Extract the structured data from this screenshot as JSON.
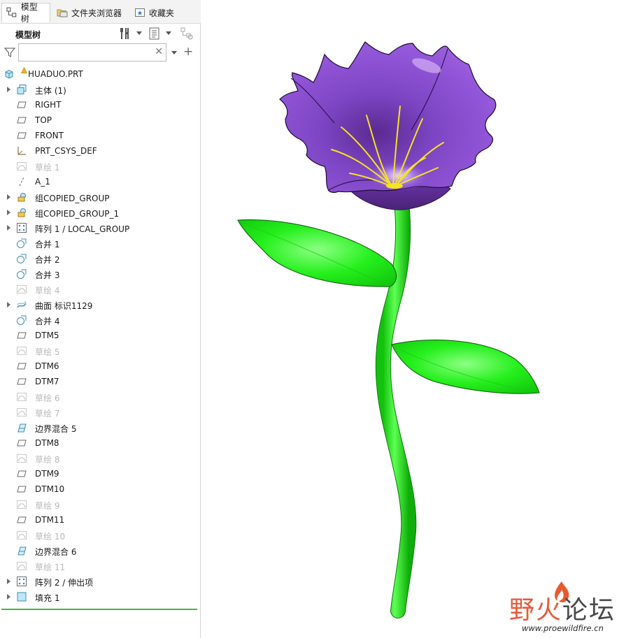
{
  "tabs": [
    {
      "label": "模型树",
      "icon": "model-tree-icon",
      "active": true
    },
    {
      "label": "文件夹浏览器",
      "icon": "folder-browser-icon",
      "active": false
    },
    {
      "label": "收藏夹",
      "icon": "favorites-icon",
      "active": false
    }
  ],
  "tree_header": {
    "title": "模型树"
  },
  "search": {
    "value": "",
    "placeholder": ""
  },
  "tree": [
    {
      "label": "HUADUO.PRT",
      "icon": "part-icon",
      "expandable": false,
      "dim": false,
      "root": true,
      "warning": true
    },
    {
      "label": "主体 (1)",
      "icon": "body-icon",
      "expandable": true,
      "dim": false
    },
    {
      "label": "RIGHT",
      "icon": "datum-plane-icon",
      "expandable": false,
      "dim": false
    },
    {
      "label": "TOP",
      "icon": "datum-plane-icon",
      "expandable": false,
      "dim": false
    },
    {
      "label": "FRONT",
      "icon": "datum-plane-icon",
      "expandable": false,
      "dim": false
    },
    {
      "label": "PRT_CSYS_DEF",
      "icon": "coordinate-system-icon",
      "expandable": false,
      "dim": false
    },
    {
      "label": "草绘 1",
      "icon": "sketch-icon",
      "expandable": false,
      "dim": true
    },
    {
      "label": "A_1",
      "icon": "datum-axis-icon",
      "expandable": false,
      "dim": false
    },
    {
      "label": "组COPIED_GROUP",
      "icon": "group-icon",
      "expandable": true,
      "dim": false
    },
    {
      "label": "组COPIED_GROUP_1",
      "icon": "group-icon",
      "expandable": true,
      "dim": false
    },
    {
      "label": "阵列 1 / LOCAL_GROUP",
      "icon": "pattern-icon",
      "expandable": true,
      "dim": false
    },
    {
      "label": "合并 1",
      "icon": "merge-icon",
      "expandable": false,
      "dim": false
    },
    {
      "label": "合并 2",
      "icon": "merge-icon",
      "expandable": false,
      "dim": false
    },
    {
      "label": "合并 3",
      "icon": "merge-icon",
      "expandable": false,
      "dim": false
    },
    {
      "label": "草绘 4",
      "icon": "sketch-icon",
      "expandable": false,
      "dim": true
    },
    {
      "label": "曲面 标识1129",
      "icon": "surface-icon",
      "expandable": true,
      "dim": false
    },
    {
      "label": "合并 4",
      "icon": "merge-icon",
      "expandable": false,
      "dim": false
    },
    {
      "label": "DTM5",
      "icon": "datum-plane-icon",
      "expandable": false,
      "dim": false
    },
    {
      "label": "草绘 5",
      "icon": "sketch-icon",
      "expandable": false,
      "dim": true
    },
    {
      "label": "DTM6",
      "icon": "datum-plane-icon",
      "expandable": false,
      "dim": false
    },
    {
      "label": "DTM7",
      "icon": "datum-plane-icon",
      "expandable": false,
      "dim": false
    },
    {
      "label": "草绘 6",
      "icon": "sketch-icon",
      "expandable": false,
      "dim": true
    },
    {
      "label": "草绘 7",
      "icon": "sketch-icon",
      "expandable": false,
      "dim": true
    },
    {
      "label": "边界混合 5",
      "icon": "boundary-blend-icon",
      "expandable": false,
      "dim": false
    },
    {
      "label": "DTM8",
      "icon": "datum-plane-icon",
      "expandable": false,
      "dim": false
    },
    {
      "label": "草绘 8",
      "icon": "sketch-icon",
      "expandable": false,
      "dim": true
    },
    {
      "label": "DTM9",
      "icon": "datum-plane-icon",
      "expandable": false,
      "dim": false
    },
    {
      "label": "DTM10",
      "icon": "datum-plane-icon",
      "expandable": false,
      "dim": false
    },
    {
      "label": "草绘 9",
      "icon": "sketch-icon",
      "expandable": false,
      "dim": true
    },
    {
      "label": "DTM11",
      "icon": "datum-plane-icon",
      "expandable": false,
      "dim": false
    },
    {
      "label": "草绘 10",
      "icon": "sketch-icon",
      "expandable": false,
      "dim": true
    },
    {
      "label": "边界混合 6",
      "icon": "boundary-blend-icon",
      "expandable": false,
      "dim": false
    },
    {
      "label": "草绘 11",
      "icon": "sketch-icon",
      "expandable": false,
      "dim": true
    },
    {
      "label": "阵列 2 / 伸出项",
      "icon": "pattern-icon",
      "expandable": true,
      "dim": false
    },
    {
      "label": "填充 1",
      "icon": "fill-icon",
      "expandable": true,
      "dim": false
    }
  ],
  "watermark": {
    "title_part1": "野火",
    "title_part2": "论坛",
    "url": "www.proewildfire.cn"
  },
  "colors": {
    "petal": "#8a4fd0",
    "petal_dark": "#5a2c8c",
    "stamen": "#f3e21c",
    "stem_leaf": "#22ee18",
    "accent_line": "#3cbc3c"
  }
}
